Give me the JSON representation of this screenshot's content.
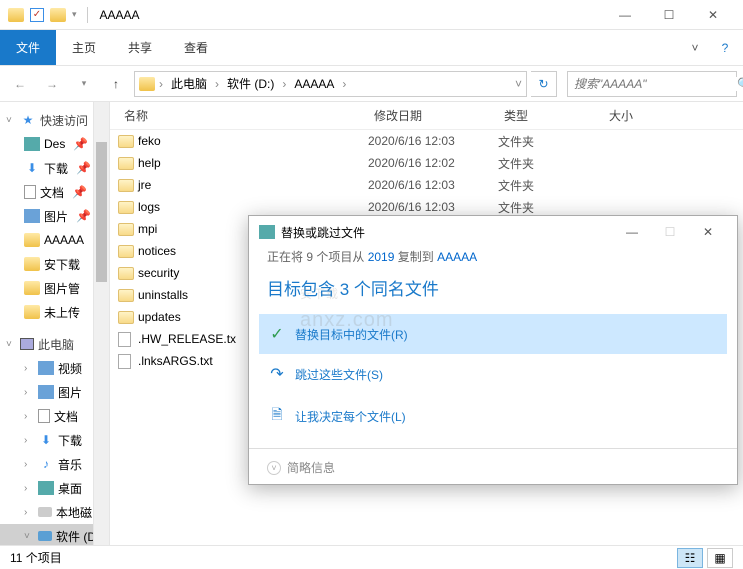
{
  "titlebar": {
    "title": "AAAAA"
  },
  "ribbon": {
    "file": "文件",
    "home": "主页",
    "share": "共享",
    "view": "查看"
  },
  "breadcrumb": {
    "pc": "此电脑",
    "drive": "软件 (D:)",
    "folder": "AAAAA"
  },
  "search": {
    "placeholder": "搜索\"AAAAA\""
  },
  "tree": {
    "quick": "快速访问",
    "des": "Des",
    "downloads": "下载",
    "docs": "文档",
    "pics": "图片",
    "folderA": "AAAAA",
    "anxia": "安下载",
    "picmgr": "图片管",
    "noup": "未上传",
    "thispc": "此电脑",
    "video": "视频",
    "pics2": "图片",
    "docs2": "文档",
    "downloads2": "下载",
    "music": "音乐",
    "desktop": "桌面",
    "localdisk": "本地磁",
    "softdisk": "软件 (D"
  },
  "columns": {
    "name": "名称",
    "date": "修改日期",
    "type": "类型",
    "size": "大小"
  },
  "files": [
    {
      "name": "feko",
      "date": "2020/6/16 12:03",
      "type": "文件夹",
      "kind": "folder"
    },
    {
      "name": "help",
      "date": "2020/6/16 12:02",
      "type": "文件夹",
      "kind": "folder"
    },
    {
      "name": "jre",
      "date": "2020/6/16 12:03",
      "type": "文件夹",
      "kind": "folder"
    },
    {
      "name": "logs",
      "date": "2020/6/16 12:03",
      "type": "文件夹",
      "kind": "folder"
    },
    {
      "name": "mpi",
      "date": "2020/6/16 12:03",
      "type": "文件夹",
      "kind": "folder"
    },
    {
      "name": "notices",
      "date": "",
      "type": "",
      "kind": "folder"
    },
    {
      "name": "security",
      "date": "",
      "type": "",
      "kind": "folder"
    },
    {
      "name": "uninstalls",
      "date": "",
      "type": "",
      "kind": "folder"
    },
    {
      "name": "updates",
      "date": "",
      "type": "",
      "kind": "folder"
    },
    {
      "name": ".HW_RELEASE.tx",
      "date": "",
      "type": "",
      "kind": "txt"
    },
    {
      "name": ".lnksARGS.txt",
      "date": "",
      "type": "",
      "kind": "txt"
    }
  ],
  "status": {
    "count": "11 个项目"
  },
  "dialog": {
    "title": "替换或跳过文件",
    "sub_pre": "正在将 9 个项目从 ",
    "sub_src": "2019",
    "sub_mid": " 复制到 ",
    "sub_dst": "AAAAA",
    "heading": "目标包含 3 个同名文件",
    "opt_replace": "替换目标中的文件(R)",
    "opt_skip": "跳过这些文件(S)",
    "opt_decide": "让我决定每个文件(L)",
    "more": "简略信息"
  },
  "watermark": {
    "main": "安下载",
    "sub": "anxz.com"
  }
}
